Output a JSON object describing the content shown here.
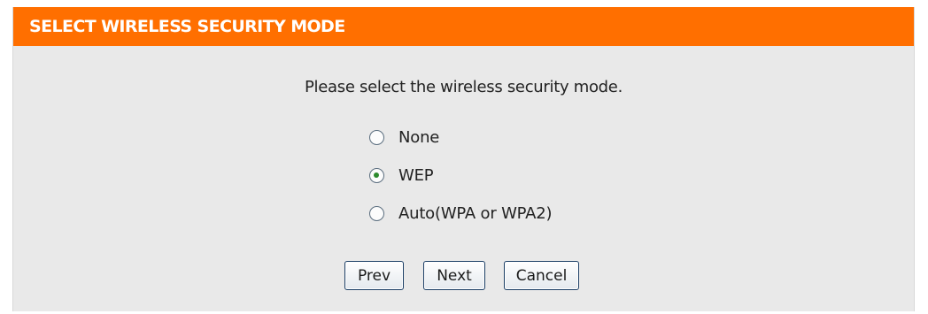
{
  "header": {
    "title": "SELECT WIRELESS SECURITY MODE"
  },
  "prompt": "Please select the wireless security mode.",
  "security_modes": [
    {
      "label": "None",
      "selected": false
    },
    {
      "label": "WEP",
      "selected": true
    },
    {
      "label": "Auto(WPA or WPA2)",
      "selected": false
    }
  ],
  "buttons": {
    "prev": "Prev",
    "next": "Next",
    "cancel": "Cancel"
  },
  "colors": {
    "header_bg": "#ff6f00",
    "panel_bg": "#e9e9e9",
    "radio_dot": "#2d8a2d"
  }
}
